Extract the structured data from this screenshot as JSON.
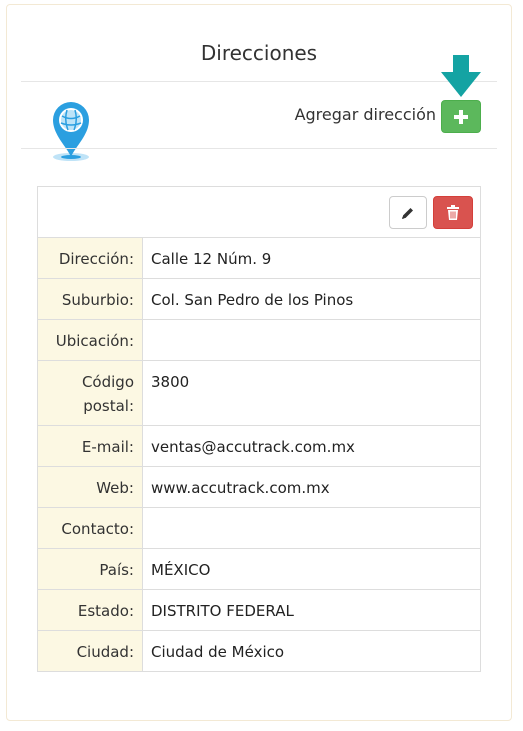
{
  "header": {
    "title": "Direcciones",
    "add_label": "Agregar dirección"
  },
  "colors": {
    "accent_teal": "#14a3a3",
    "pin_blue": "#2b9fe0",
    "add_green": "#5cb85c",
    "delete_red": "#d9534f",
    "label_bg": "#fcf8e3"
  },
  "icons": {
    "pin": "map-pin-icon",
    "arrow": "arrow-down-icon",
    "add": "plus-icon",
    "edit": "pencil-icon",
    "delete": "trash-icon"
  },
  "address": {
    "rows": [
      {
        "label": "Dirección:",
        "value": "Calle 12 Núm. 9"
      },
      {
        "label": "Suburbio:",
        "value": "Col. San Pedro de los Pinos"
      },
      {
        "label": "Ubicación:",
        "value": ""
      },
      {
        "label": "Código postal:",
        "value": "3800"
      },
      {
        "label": "E-mail:",
        "value": "ventas@accutrack.com.mx"
      },
      {
        "label": "Web:",
        "value": "www.accutrack.com.mx"
      },
      {
        "label": "Contacto:",
        "value": ""
      },
      {
        "label": "País:",
        "value": "MÉXICO"
      },
      {
        "label": "Estado:",
        "value": "DISTRITO FEDERAL"
      },
      {
        "label": "Ciudad:",
        "value": "Ciudad de México"
      }
    ]
  }
}
